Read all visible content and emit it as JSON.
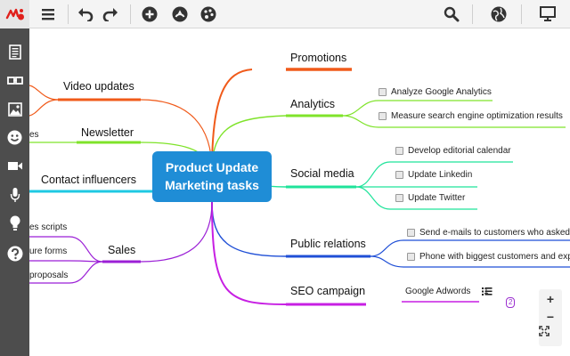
{
  "toolbar": {
    "logo": "mindmup-logo-icon",
    "buttons": [
      "menu-icon",
      "undo-icon",
      "redo-icon",
      "add-node-icon",
      "attachment-icon",
      "palette-icon",
      "search-icon",
      "globe-icon",
      "presentation-icon"
    ]
  },
  "sidebar": {
    "buttons": [
      "document-icon",
      "glasses-icon",
      "image-icon",
      "emoji-icon",
      "video-icon",
      "microphone-icon",
      "lightbulb-icon",
      "help-icon"
    ]
  },
  "map": {
    "central": {
      "line1": "Product Update",
      "line2": "Marketing tasks"
    },
    "left": {
      "video_updates": "Video updates",
      "newsletter": "Newsletter",
      "newsletter_child": "es",
      "contact_influencers": "Contact influencers",
      "sales": "Sales",
      "sales_children": [
        "es scripts",
        "ure forms",
        "proposals"
      ]
    },
    "right": {
      "promotions": "Promotions",
      "analytics": "Analytics",
      "analytics_tasks": [
        "Analyze Google Analytics",
        "Measure search engine optimization results"
      ],
      "social_media": "Social media",
      "social_tasks": [
        "Develop editorial calendar",
        "Update Linkedin",
        "Update Twitter"
      ],
      "public_relations": "Public relations",
      "pr_tasks": [
        "Send e-mails to customers who asked",
        "Phone with biggest customers and exp"
      ],
      "seo_campaign": "SEO campaign",
      "seo_child": "Google Adwords",
      "seo_list_count": "1",
      "seo_badge": "2"
    }
  },
  "colors": {
    "toolbar_bg": "#f4f4f4",
    "sidebar_bg": "#4d4d4d",
    "central_bg": "#1f8dd6",
    "promotions": "#f05a1a",
    "analytics": "#7fe32a",
    "social_media": "#1fe39a",
    "public_relations": "#1f4fd6",
    "seo_campaign": "#c71fe3",
    "video_updates": "#f05a1a",
    "newsletter": "#7fe32a",
    "contact_influencers": "#1fc9e3",
    "sales": "#9b1fd6"
  },
  "zoom": {
    "in": "+",
    "out": "−"
  }
}
